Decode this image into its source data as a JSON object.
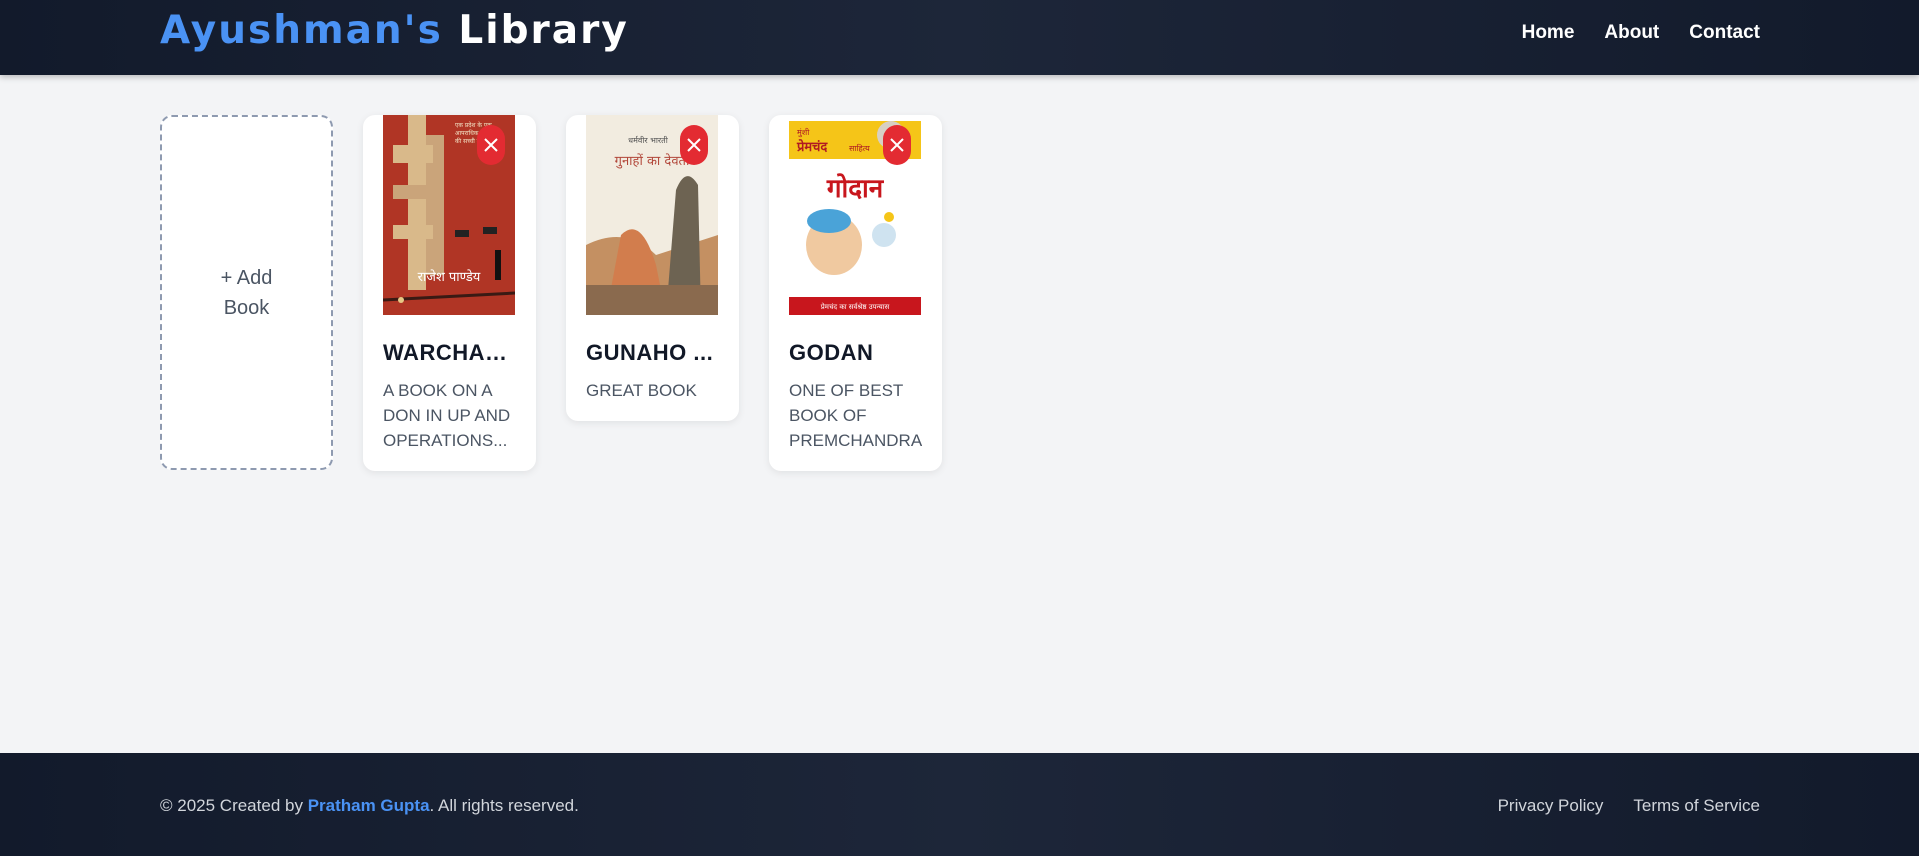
{
  "header": {
    "brand_part1": "Ayushman's",
    "brand_part2": "Library",
    "nav": [
      "Home",
      "About",
      "Contact"
    ]
  },
  "add_card": {
    "label": "+ Add Book"
  },
  "books": [
    {
      "title": "WARCHAS...",
      "description": "A BOOK ON A DON IN UP AND OPERATIONS...",
      "cover_text": "राजेश पाण्डेय"
    },
    {
      "title": "GUNAHO ...",
      "description": "GREAT BOOK",
      "cover_text": "गुनाहों का देवता"
    },
    {
      "title": "GODAN",
      "description": "ONE OF BEST BOOK OF PREMCHANDRA",
      "cover_text": "गोदान"
    }
  ],
  "footer": {
    "copy_prefix": "© 2025 Created by",
    "author": "Pratham Gupta",
    "copy_suffix": ". All rights reserved.",
    "links": [
      "Privacy Policy",
      "Terms of Service"
    ]
  },
  "colors": {
    "accent": "#4a92f4",
    "danger": "#e32b32",
    "header_bg": "#1a2234"
  }
}
